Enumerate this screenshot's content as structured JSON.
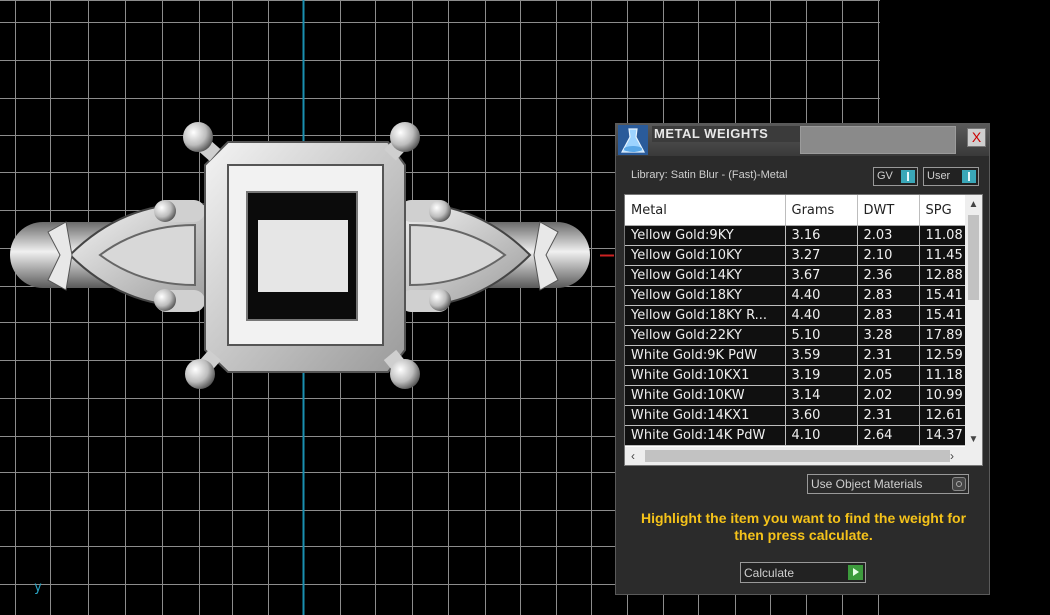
{
  "viewport": {
    "axis_label": "y",
    "grid_color": "#8c8c8c",
    "axis_color": "#1a8fb0"
  },
  "dialog": {
    "title": "METAL WEIGHTS",
    "close_label": "X",
    "library_label": "Library: Satin Blur - (Fast)-Metal",
    "gv_label": "GV",
    "user_label": "User",
    "columns": [
      "Metal",
      "Grams",
      "DWT",
      "SPG"
    ],
    "rows": [
      {
        "metal": "Yellow Gold:9KY",
        "grams": "3.16",
        "dwt": "2.03",
        "spg": "11.08"
      },
      {
        "metal": "Yellow Gold:10KY",
        "grams": "3.27",
        "dwt": "2.10",
        "spg": "11.45"
      },
      {
        "metal": "Yellow Gold:14KY",
        "grams": "3.67",
        "dwt": "2.36",
        "spg": "12.88"
      },
      {
        "metal": "Yellow Gold:18KY",
        "grams": "4.40",
        "dwt": "2.83",
        "spg": "15.41"
      },
      {
        "metal": "Yellow Gold:18KY R...",
        "grams": "4.40",
        "dwt": "2.83",
        "spg": "15.41"
      },
      {
        "metal": "Yellow Gold:22KY",
        "grams": "5.10",
        "dwt": "3.28",
        "spg": "17.89"
      },
      {
        "metal": "White Gold:9K PdW",
        "grams": "3.59",
        "dwt": "2.31",
        "spg": "12.59"
      },
      {
        "metal": "White Gold:10KX1",
        "grams": "3.19",
        "dwt": "2.05",
        "spg": "11.18"
      },
      {
        "metal": "White Gold:10KW",
        "grams": "3.14",
        "dwt": "2.02",
        "spg": "10.99"
      },
      {
        "metal": "White Gold:14KX1",
        "grams": "3.60",
        "dwt": "2.31",
        "spg": "12.61"
      },
      {
        "metal": "White Gold:14K PdW",
        "grams": "4.10",
        "dwt": "2.64",
        "spg": "14.37"
      }
    ],
    "materials_label": "Use Object Materials",
    "instruction": "Highlight the item you want to find the weight for then press calculate.",
    "calculate_label": "Calculate",
    "accent_color": "#f5c31a",
    "toggle_color": "#3aa7b8",
    "calculate_icon_color": "#3d9b3d"
  }
}
